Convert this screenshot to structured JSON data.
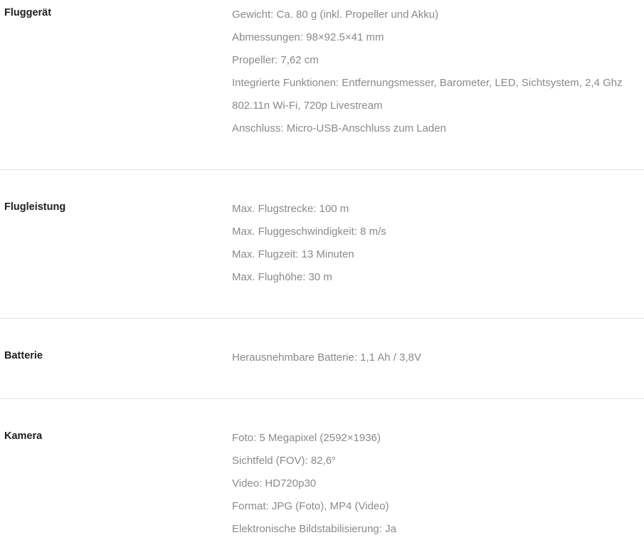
{
  "specs": [
    {
      "title": "Fluggerät",
      "items": [
        "Gewicht: Ca. 80 g (inkl. Propeller und Akku)",
        "Abmessungen: 98×92.5×41 mm",
        "Propeller: 7,62 cm",
        "Integrierte Funktionen: Entfernungsmesser, Barometer, LED, Sichtsystem, 2,4 Ghz",
        "802.11n Wi-Fi, 720p Livestream",
        "Anschluss: Micro-USB-Anschluss zum Laden"
      ]
    },
    {
      "title": "Flugleistung",
      "items": [
        "Max. Flugstrecke: 100 m",
        "Max. Fluggeschwindigkeit: 8 m/s",
        "Max. Flugzeit: 13 Minuten",
        "Max. Flughöhe: 30 m"
      ]
    },
    {
      "title": "Batterie",
      "items": [
        "Herausnehmbare Batterie: 1,1 Ah / 3,8V"
      ]
    },
    {
      "title": "Kamera",
      "items": [
        "Foto: 5 Megapixel (2592×1936)",
        "Sichtfeld (FOV): 82,6°",
        "Video: HD720p30",
        "Format: JPG (Foto), MP4 (Video)",
        "Elektronische Bildstabilisierung: Ja"
      ]
    }
  ]
}
